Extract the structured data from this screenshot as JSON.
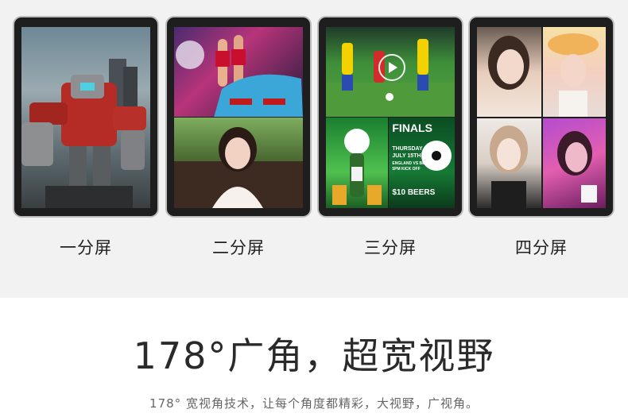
{
  "monitors": [
    {
      "label": "一分屏"
    },
    {
      "label": "二分屏"
    },
    {
      "label": "三分屏"
    },
    {
      "label": "四分屏"
    }
  ],
  "screen3": {
    "poster_line1": "FINALS",
    "poster_line2": "THURSDAY",
    "poster_line3": "JULY 15TH",
    "poster_line4": "ENGLAND VS BELGIUM",
    "poster_line5": "5PM KICK OFF",
    "poster_price": "$10 BEERS"
  },
  "headline": "178°广角，超宽视野",
  "subline": "178° 宽视角技术，让每个角度都精彩，大视野，广视角。",
  "colors": {
    "background_top": "#f2f2f2",
    "monitor_frame": "#1e1e1e",
    "headline": "#2a2a2a",
    "subline": "#666666"
  }
}
